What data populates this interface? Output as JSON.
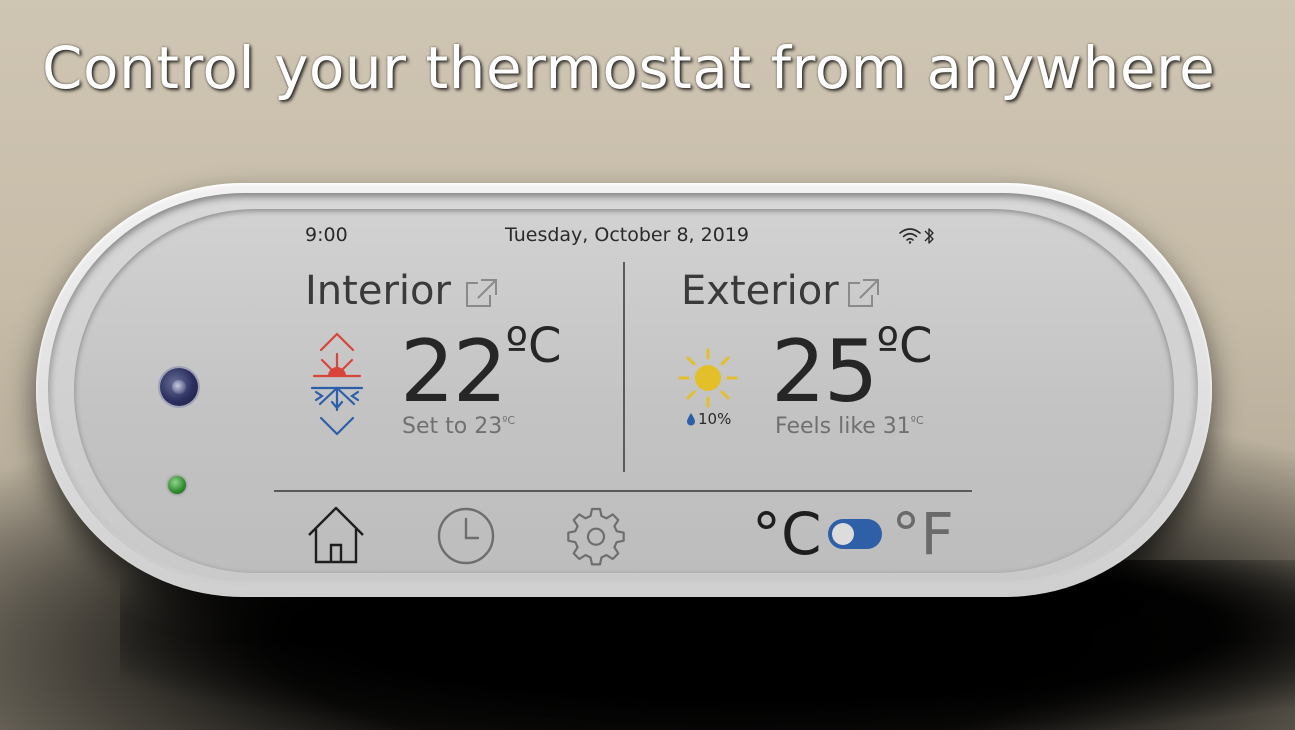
{
  "headline": "Control your thermostat from anywhere",
  "status_bar": {
    "time": "9:00",
    "date": "Tuesday, October 8, 2019",
    "icons": [
      "wifi-icon",
      "bluetooth-icon"
    ]
  },
  "interior": {
    "title": "Interior",
    "temperature": "22",
    "unit": "ºC",
    "setpoint_prefix": "Set to 23",
    "setpoint_unit": "ºC",
    "icon": "heat-cool-icon"
  },
  "exterior": {
    "title": "Exterior",
    "temperature": "25",
    "unit": "ºC",
    "humidity": "10%",
    "feels_prefix": "Feels like 31",
    "feels_unit": "ºC",
    "icon": "sun-icon"
  },
  "nav": {
    "items": [
      "home-icon",
      "clock-icon",
      "gear-icon"
    ]
  },
  "units_toggle": {
    "celsius_label": "°C",
    "fahrenheit_label": "°F",
    "selected": "°C"
  },
  "colors": {
    "heat": "#d9443a",
    "cool": "#2d5fa8",
    "sun": "#e3bf2a",
    "toggle": "#2f5fa7"
  }
}
